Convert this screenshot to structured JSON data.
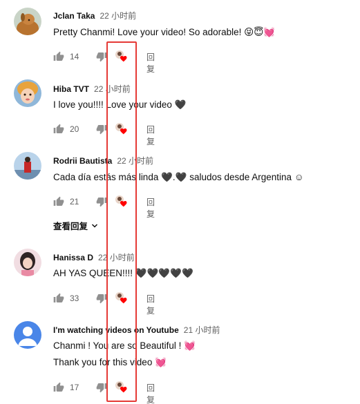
{
  "comments": [
    {
      "author": "Jclan Taka",
      "time": "22 小时前",
      "lines": [
        "Pretty Chanmi! Love your video! So adorable! 😝😇💓"
      ],
      "likes": "14",
      "reply_label": "回复"
    },
    {
      "author": "Hiba TVT",
      "time": "22 小时前",
      "lines": [
        "I love you!!!! Love your video 🖤"
      ],
      "likes": "20",
      "reply_label": "回复"
    },
    {
      "author": "Rodrii Bautista",
      "time": "22 小时前",
      "lines": [
        "Cada día estás más linda 🖤.🖤 saludos desde Argentina ☺"
      ],
      "likes": "21",
      "reply_label": "回复"
    },
    {
      "author": "Hanissa D",
      "time": "22 小时前",
      "lines": [
        "AH YAS QUEEN!!!! 🖤🖤🖤🖤🖤"
      ],
      "likes": "33",
      "reply_label": "回复"
    },
    {
      "author": "I'm watching videos on Youtube",
      "time": "21 小时前",
      "lines": [
        "Chanmi ! You are so Beautiful ! 💓",
        "Thank you for this video 💓"
      ],
      "likes": "17",
      "reply_label": "回复"
    }
  ],
  "view_replies_label": "查看回复",
  "colors": {
    "highlight": "#e53935",
    "heart": "#ff0000",
    "default_avatar": "#4a86e8"
  }
}
